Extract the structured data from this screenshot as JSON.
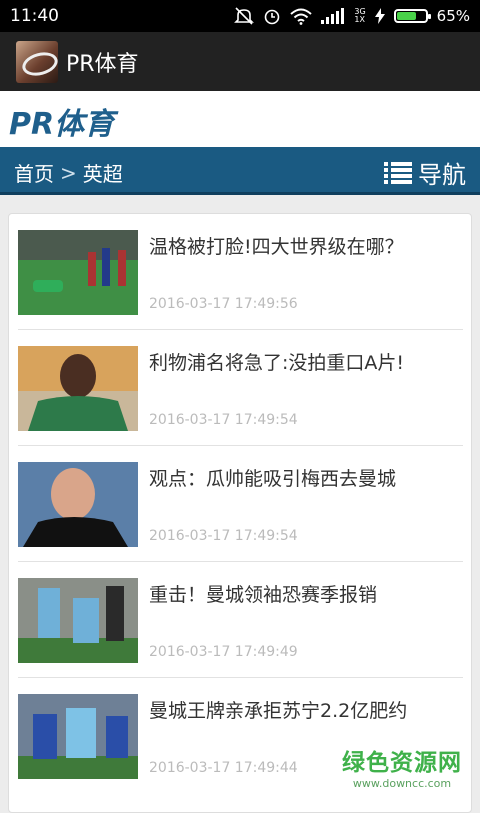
{
  "status_bar": {
    "time": "11:40",
    "network_top": "3G",
    "network_bottom": "1X",
    "battery": "65%"
  },
  "app_bar": {
    "title": "PR体育"
  },
  "site": {
    "brand": "PR体育"
  },
  "nav": {
    "home": "首页",
    "separator": ">",
    "section": "英超",
    "menu_label": "导航"
  },
  "articles": [
    {
      "title": "温格被打脸!四大世界级在哪？",
      "date": "2016-03-17 17:49:56",
      "thumb_color": "#3f8f45"
    },
    {
      "title": "利物浦名将急了:没拍重口A片!",
      "date": "2016-03-17 17:49:54",
      "thumb_color": "#2d7a4a"
    },
    {
      "title": "观点：瓜帅能吸引梅西去曼城",
      "date": "2016-03-17 17:49:54",
      "thumb_color": "#b08d7d"
    },
    {
      "title": "重击！曼城领袖恐赛季报销",
      "date": "2016-03-17 17:49:49",
      "thumb_color": "#6fb0d8"
    },
    {
      "title": "曼城王牌亲承拒苏宁2.2亿肥约",
      "date": "2016-03-17 17:49:44",
      "thumb_color": "#3a62b0"
    }
  ],
  "watermark": {
    "text": "绿色资源网",
    "url": "www.downcc.com"
  }
}
